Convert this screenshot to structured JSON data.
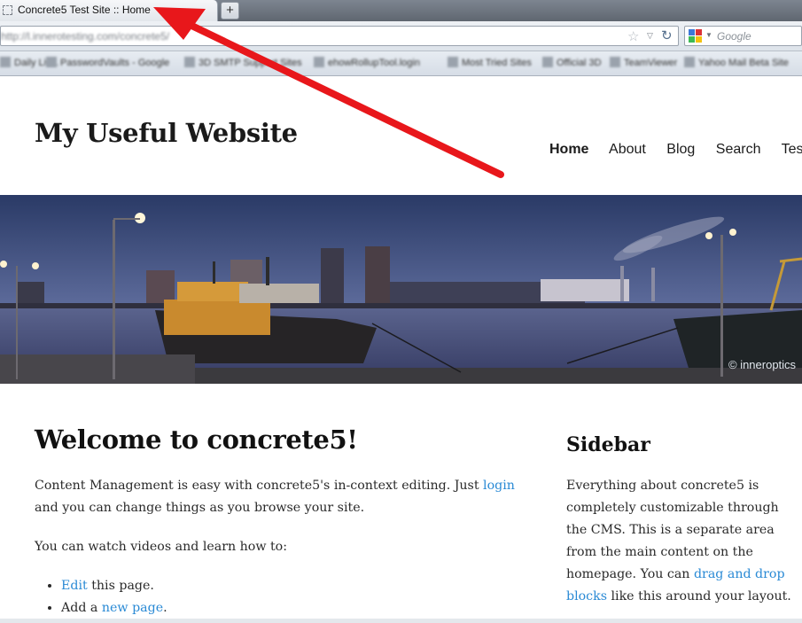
{
  "browser": {
    "tab_title": "Concrete5 Test Site :: Home",
    "new_tab_label": "+",
    "url": "http://l.innerotesting.com/concrete5/",
    "search_placeholder": "Google",
    "star_icon": "☆",
    "dropdown_icon": "▽",
    "reload_icon": "↻",
    "bookmarks": [
      "Daily Liv...",
      "PasswordVaults - Google",
      "3D SMTP Support Sites",
      "ehowRollupTool.login",
      "Most Tried Sites",
      "Official 3D",
      "TeamViewer",
      "Yahoo Mail Beta Site"
    ]
  },
  "site": {
    "title": "My Useful Website",
    "nav": [
      "Home",
      "About",
      "Blog",
      "Search",
      "Test"
    ],
    "active_nav": "Home"
  },
  "hero": {
    "credit": "© inneroptics"
  },
  "main": {
    "heading": "Welcome to concrete5!",
    "p1_before": "Content Management is easy with concrete5's in-context editing. Just ",
    "p1_link": "login",
    "p1_after": " and you can change things as you browse your site.",
    "p2": "You can watch videos and learn how to:",
    "list": [
      {
        "link": "Edit",
        "prefix": "",
        "suffix": " this page."
      },
      {
        "link": "new page",
        "prefix": "Add a ",
        "suffix": "."
      }
    ]
  },
  "sidebar": {
    "title": "Sidebar",
    "text_before": "Everything about concrete5 is completely customizable through the CMS. This is a separate area from the main content on the homepage. You can ",
    "link": "drag and drop blocks",
    "text_after": " like this around your layout."
  },
  "colors": {
    "link": "#2a8ad5",
    "annotation_arrow": "#e8171b"
  }
}
